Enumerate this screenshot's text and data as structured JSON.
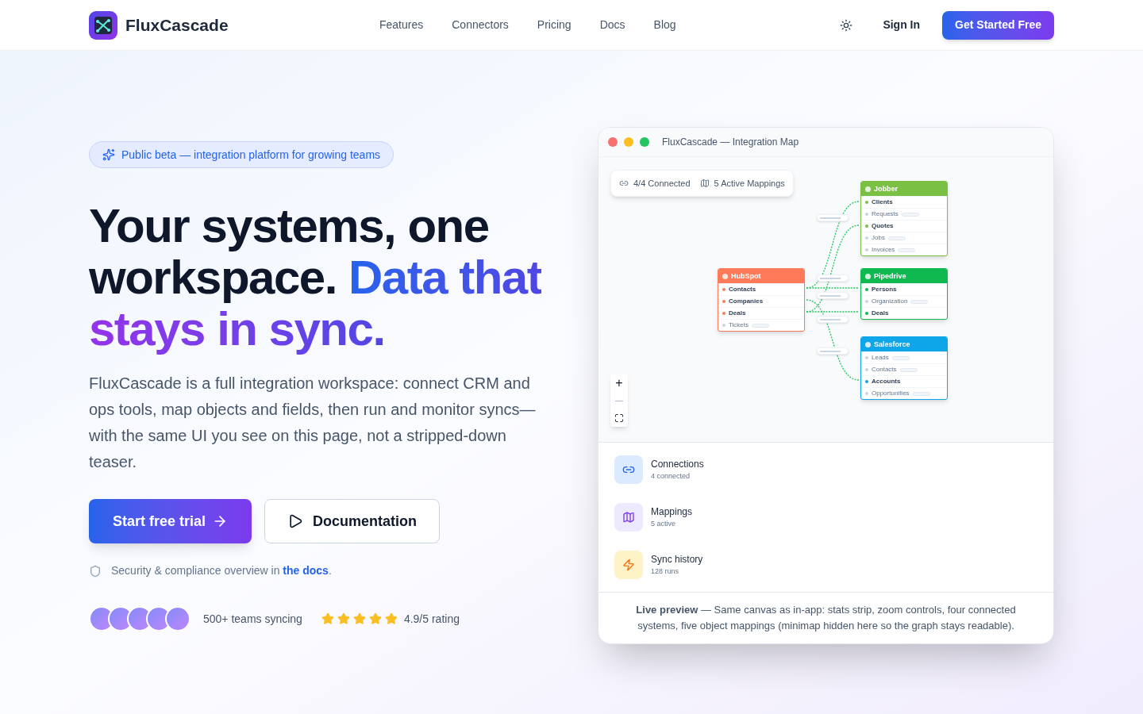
{
  "brand": {
    "name": "FluxCascade"
  },
  "nav": {
    "links": [
      "Features",
      "Connectors",
      "Pricing",
      "Docs",
      "Blog"
    ],
    "sign_in": "Sign In",
    "cta": "Get Started Free"
  },
  "hero": {
    "badge": "Public beta — integration platform for growing teams",
    "headline": [
      {
        "text": "Your systems, one workspace. ",
        "kind": "plain"
      },
      {
        "text": "Data that",
        "kind": "blue"
      },
      {
        "text": " stays in sync.",
        "kind": "purple"
      }
    ],
    "description": "FluxCascade is a full integration workspace: connect CRM and ops tools, map objects and fields, then run and monitor syncs—with the same UI you see on this page, not a stripped-down teaser.",
    "primary_button": "Start free trial",
    "secondary_button": "Documentation",
    "security_note": "Security & compliance overview in",
    "security_link": "the docs",
    "security_end": ".",
    "social": {
      "teams": "500+ teams syncing",
      "stars": 5,
      "rating": "4.9/5 rating"
    }
  },
  "preview": {
    "title": "FluxCascade — Integration Map",
    "stats": [
      {
        "kind": "link",
        "text": "4/4 Connected"
      },
      {
        "kind": "map",
        "text": "5 Active Mappings"
      }
    ],
    "nodes": [
      {
        "name": "Jobber",
        "color": "#7ac143",
        "fields": [
          {
            "name": "Clients",
            "mapped": true
          },
          {
            "name": "Requests",
            "mapped": false
          },
          {
            "name": "Quotes",
            "mapped": true
          },
          {
            "name": "Jobs",
            "mapped": false
          },
          {
            "name": "Invoices",
            "mapped": false
          }
        ]
      },
      {
        "name": "HubSpot",
        "color": "#ff7a59",
        "fields": [
          {
            "name": "Contacts",
            "mapped": true
          },
          {
            "name": "Companies",
            "mapped": true
          },
          {
            "name": "Deals",
            "mapped": true
          },
          {
            "name": "Tickets",
            "mapped": false
          }
        ]
      },
      {
        "name": "Pipedrive",
        "color": "#10b950",
        "fields": [
          {
            "name": "Persons",
            "mapped": true
          },
          {
            "name": "Organization",
            "mapped": false
          },
          {
            "name": "Deals",
            "mapped": true
          }
        ]
      },
      {
        "name": "Salesforce",
        "color": "#0ea5e9",
        "fields": [
          {
            "name": "Leads",
            "mapped": false
          },
          {
            "name": "Contacts",
            "mapped": false
          },
          {
            "name": "Accounts",
            "mapped": true
          },
          {
            "name": "Opportunities",
            "mapped": false
          }
        ]
      }
    ],
    "zoom": {
      "in": "+",
      "out": "—"
    },
    "summary": [
      {
        "kind": "link",
        "title": "Connections",
        "sub": "4 connected"
      },
      {
        "kind": "map",
        "title": "Mappings",
        "sub": "5 active"
      },
      {
        "kind": "bolt",
        "title": "Sync history",
        "sub": "128 runs"
      }
    ],
    "footer": "**Live preview** — Same canvas as in-app: stats strip, zoom controls, four connected systems, five object mappings (minimap hidden here so the graph stays readable)."
  }
}
